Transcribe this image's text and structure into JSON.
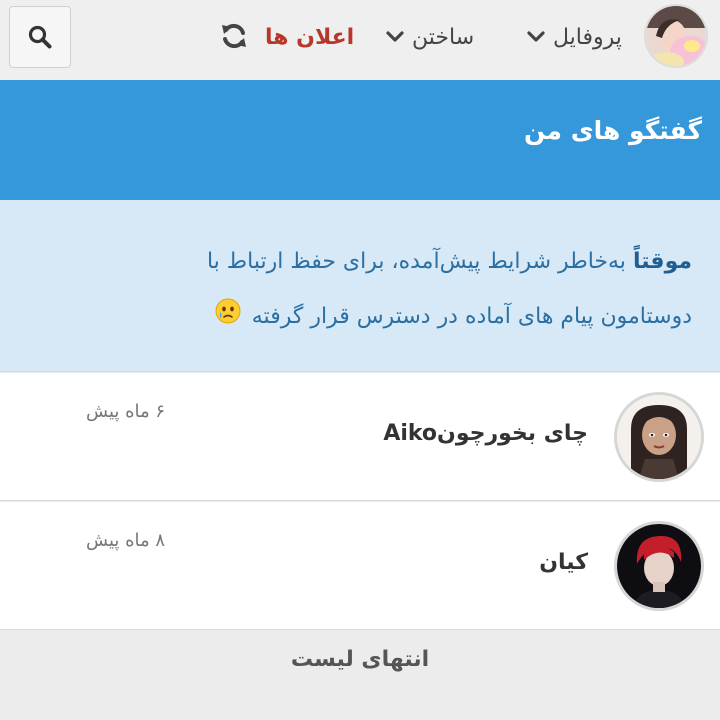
{
  "topbar": {
    "search_icon": "search-icon",
    "refresh_icon": "refresh-icon",
    "notifications_label": "اعلان ها",
    "build_label": "ساختن",
    "profile_label": "پروفایل",
    "accent_color": "#b7372b"
  },
  "header": {
    "title": "گفتگو های من",
    "color": "#3498db"
  },
  "notice": {
    "bold_text": "موقتاً",
    "text": " به‌خاطر شرایط پیش‌آمده، برای حفظ ارتباط با دوستامون پیام های آماده در دسترس قرار گرفته",
    "emoji_icon": "crying-face-icon"
  },
  "conversations": [
    {
      "name": "چای بخورچونAiko",
      "time": "۶ ماه پیش"
    },
    {
      "name": "کیان",
      "time": "۸ ماه پیش"
    }
  ],
  "list_end": "انتهای لیست"
}
